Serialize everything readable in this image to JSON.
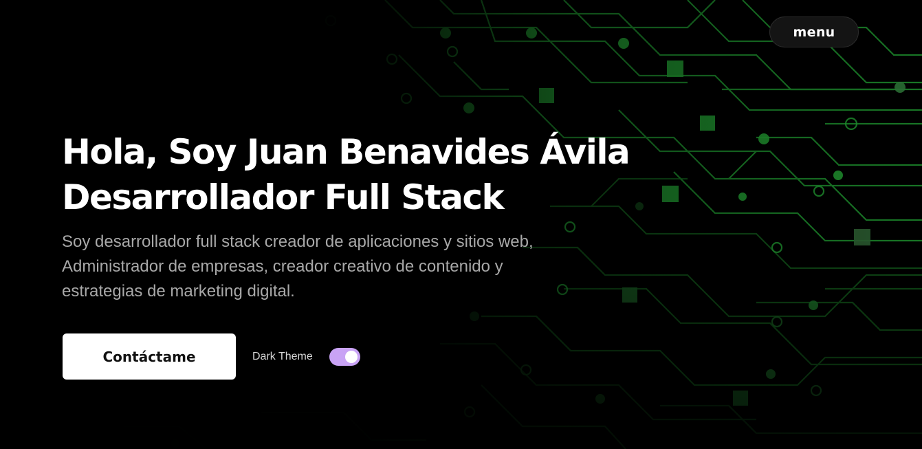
{
  "header": {
    "menu_label": "menu"
  },
  "hero": {
    "title_line1": "Hola, Soy Juan Benavides Ávila",
    "title_line2": "Desarrollador Full Stack",
    "description": "Soy desarrollador full stack creador de aplicaciones y sitios web, Administrador de empresas, creador creativo de contenido y estrategias de marketing digital.",
    "contact_label": "Contáctame",
    "theme_label": "Dark Theme",
    "dark_theme_on": true
  },
  "colors": {
    "background": "#000000",
    "circuit": "#1f7a2a",
    "toggle_on": "#c9a3f5",
    "text_primary": "#ffffff",
    "text_secondary": "#a8a8a8"
  }
}
